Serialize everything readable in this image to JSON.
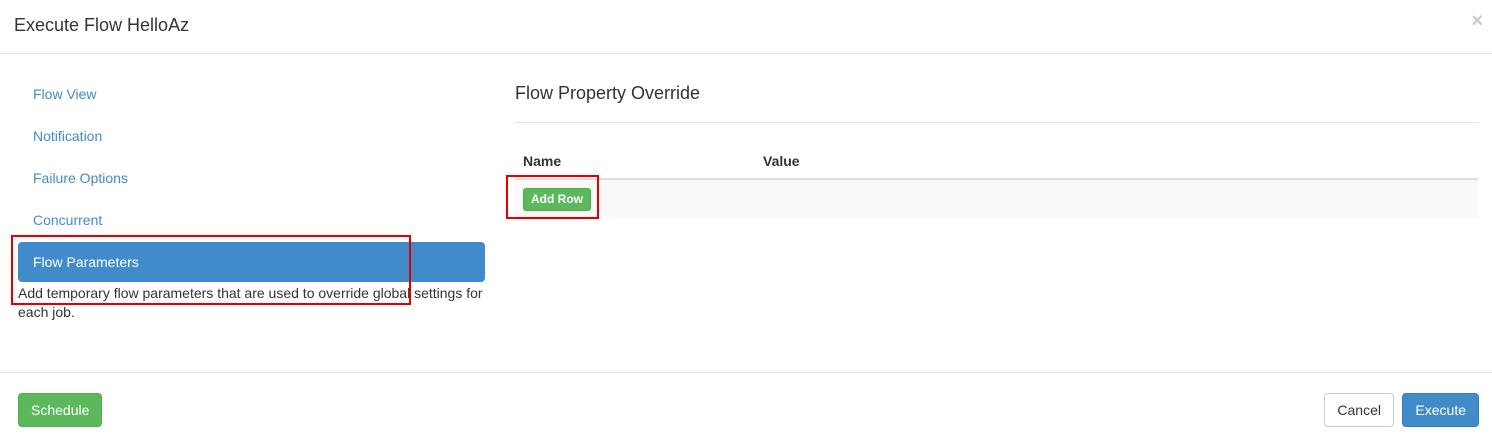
{
  "modal": {
    "title": "Execute Flow HelloAz",
    "close_glyph": "×"
  },
  "sidebar": {
    "items": [
      {
        "label": "Flow View",
        "active": false
      },
      {
        "label": "Notification",
        "active": false
      },
      {
        "label": "Failure Options",
        "active": false
      },
      {
        "label": "Concurrent",
        "active": false
      },
      {
        "label": "Flow Parameters",
        "active": true
      }
    ],
    "help_text": "Add temporary flow parameters that are used to override global settings for each job."
  },
  "main": {
    "section_title": "Flow Property Override",
    "table": {
      "columns": [
        "Name",
        "Value"
      ],
      "add_row_label": "Add Row"
    }
  },
  "footer": {
    "schedule_label": "Schedule",
    "cancel_label": "Cancel",
    "execute_label": "Execute"
  },
  "colors": {
    "primary": "#428bca",
    "success": "#5cb85c",
    "highlight": "#e00000"
  },
  "icons": {
    "close": "close-icon"
  }
}
